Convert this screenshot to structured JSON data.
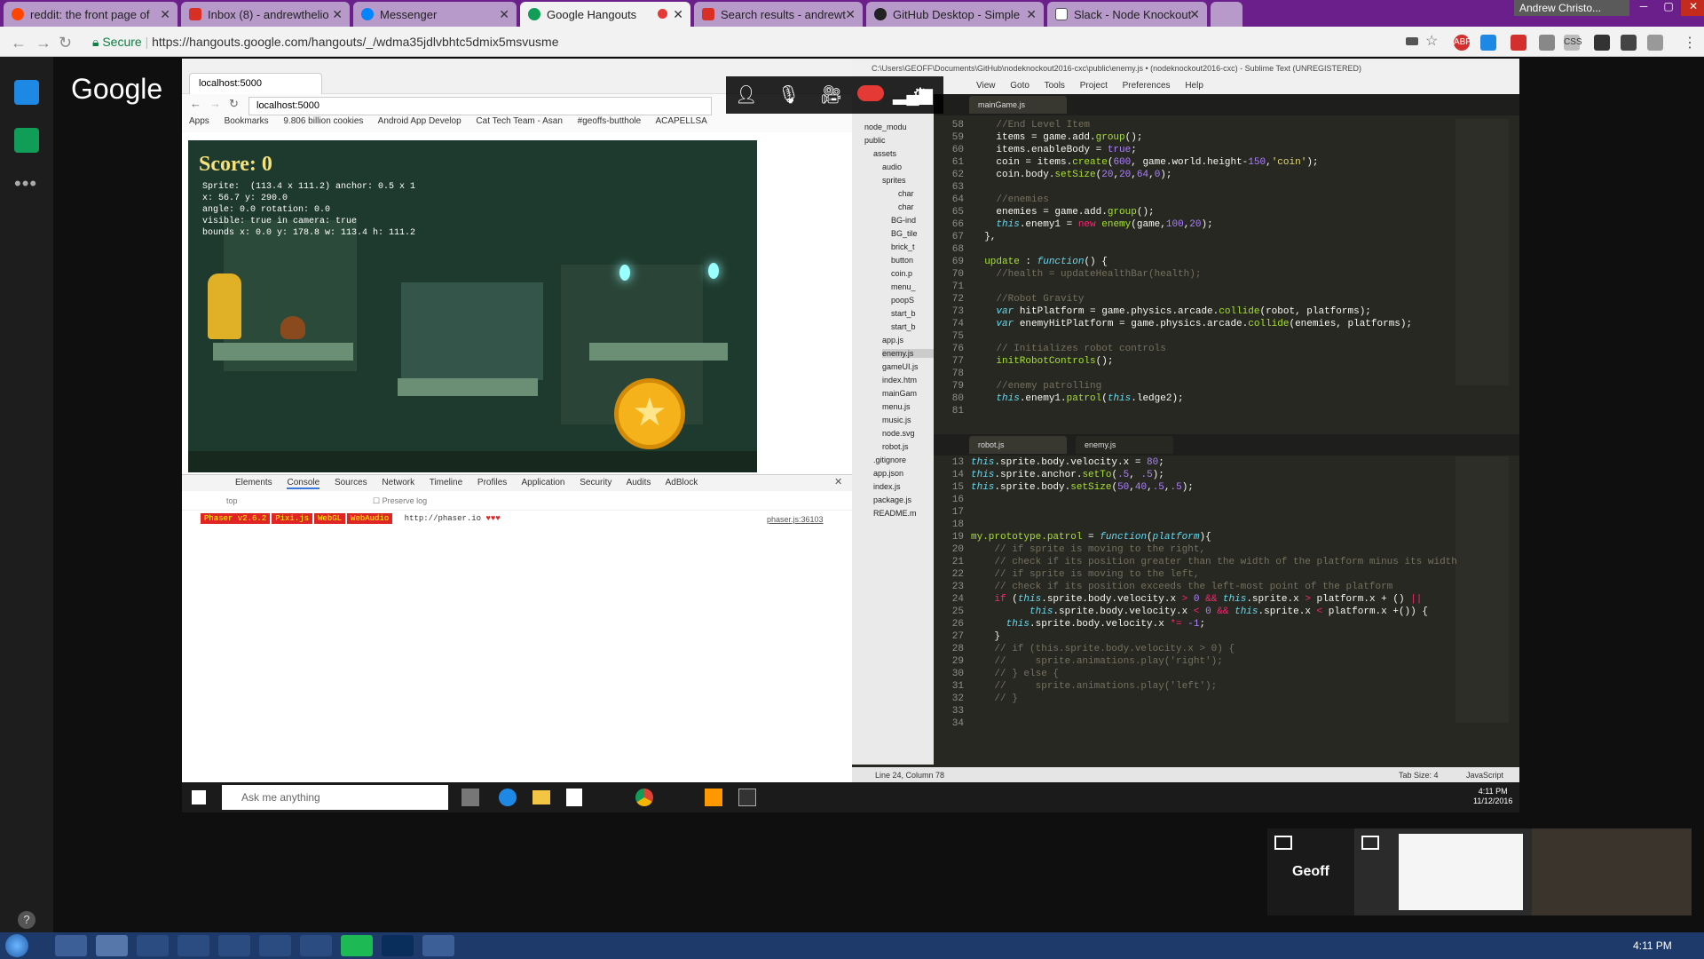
{
  "tabs": [
    {
      "title": "reddit: the front page of",
      "icon": "reddit-icon",
      "color": "#ff4500"
    },
    {
      "title": "Inbox (8) - andrewthelio",
      "icon": "gmail-icon",
      "color": "#d93025"
    },
    {
      "title": "Messenger",
      "icon": "messenger-icon",
      "color": "#0084ff"
    },
    {
      "title": "Google Hangouts",
      "icon": "hangouts-icon",
      "color": "#0f9d58"
    },
    {
      "title": "Search results - andrewt",
      "icon": "gmail-icon",
      "color": "#d93025"
    },
    {
      "title": "GitHub Desktop - Simple",
      "icon": "github-icon",
      "color": "#222222"
    },
    {
      "title": "Slack - Node Knockout",
      "icon": "page-icon",
      "color": "#555555"
    }
  ],
  "user_chip": "Andrew Christo...",
  "address": {
    "secure": "Secure",
    "url": "https://hangouts.google.com/hangouts/_/wdma35jdlvbhtc5dmix5msvusme"
  },
  "google_logo": "Google",
  "inner_chrome": {
    "tab": "localhost:5000",
    "url": "localhost:5000",
    "bookmarks": [
      "Apps",
      "Bookmarks",
      "9.806 billion cookies",
      "Android App Develop",
      "Cat Tech Team - Asan",
      "#geoffs-butthole",
      "ACAPELLSA"
    ]
  },
  "game": {
    "score": "Score: 0",
    "debug": "Sprite:  (113.4 x 111.2) anchor: 0.5 x 1\nx: 56.7 y: 290.0\nangle: 0.0 rotation: 0.0\nvisible: true in camera: true\nbounds x: 0.0 y: 178.8 w: 113.4 h: 111.2"
  },
  "devtools": {
    "tabs": [
      "Elements",
      "Console",
      "Sources",
      "Network",
      "Timeline",
      "Profiles",
      "Application",
      "Security",
      "Audits",
      "AdBlock"
    ],
    "filter": "top",
    "preserve_log": "Preserve log",
    "banner": [
      "Phaser v2.6.2",
      "Pixi.js",
      "WebGL",
      "WebAudio"
    ],
    "banner_url": "http://phaser.io",
    "source": "phaser.js:36103"
  },
  "sublime": {
    "title": "C:\\Users\\GEOFF\\Documents\\GitHub\\nodeknockout2016-cxc\\public\\enemy.js • (nodeknockout2016-cxc) - Sublime Text (UNREGISTERED)",
    "menu": [
      "View",
      "Goto",
      "Tools",
      "Project",
      "Preferences",
      "Help"
    ],
    "files": [
      "node_modu",
      "public",
      "assets",
      "audio",
      "sprites",
      "char",
      "char",
      "BG-ind",
      "BG_tile",
      "brick_t",
      "button",
      "coin.p",
      "menu_",
      "poopS",
      "start_b",
      "start_b",
      "app.js",
      "enemy.js",
      "gameUI.js",
      "index.htm",
      "mainGam",
      "menu.js",
      "music.js",
      "node.svg",
      "robot.js",
      ".gitignore",
      "app.json",
      "index.js",
      "package.js",
      "README.m"
    ],
    "pane1_tab": "mainGame.js",
    "pane2_tabs": [
      "robot.js",
      "enemy.js"
    ],
    "status_left": "Line 24, Column 78",
    "status_tab": "Tab Size: 4",
    "status_lang": "JavaScript"
  },
  "cortana": "Ask me anything",
  "inner_clock": {
    "time": "4:11 PM",
    "date": "11/12/2016"
  },
  "participant": "Geoff",
  "clock": "4:11 PM"
}
